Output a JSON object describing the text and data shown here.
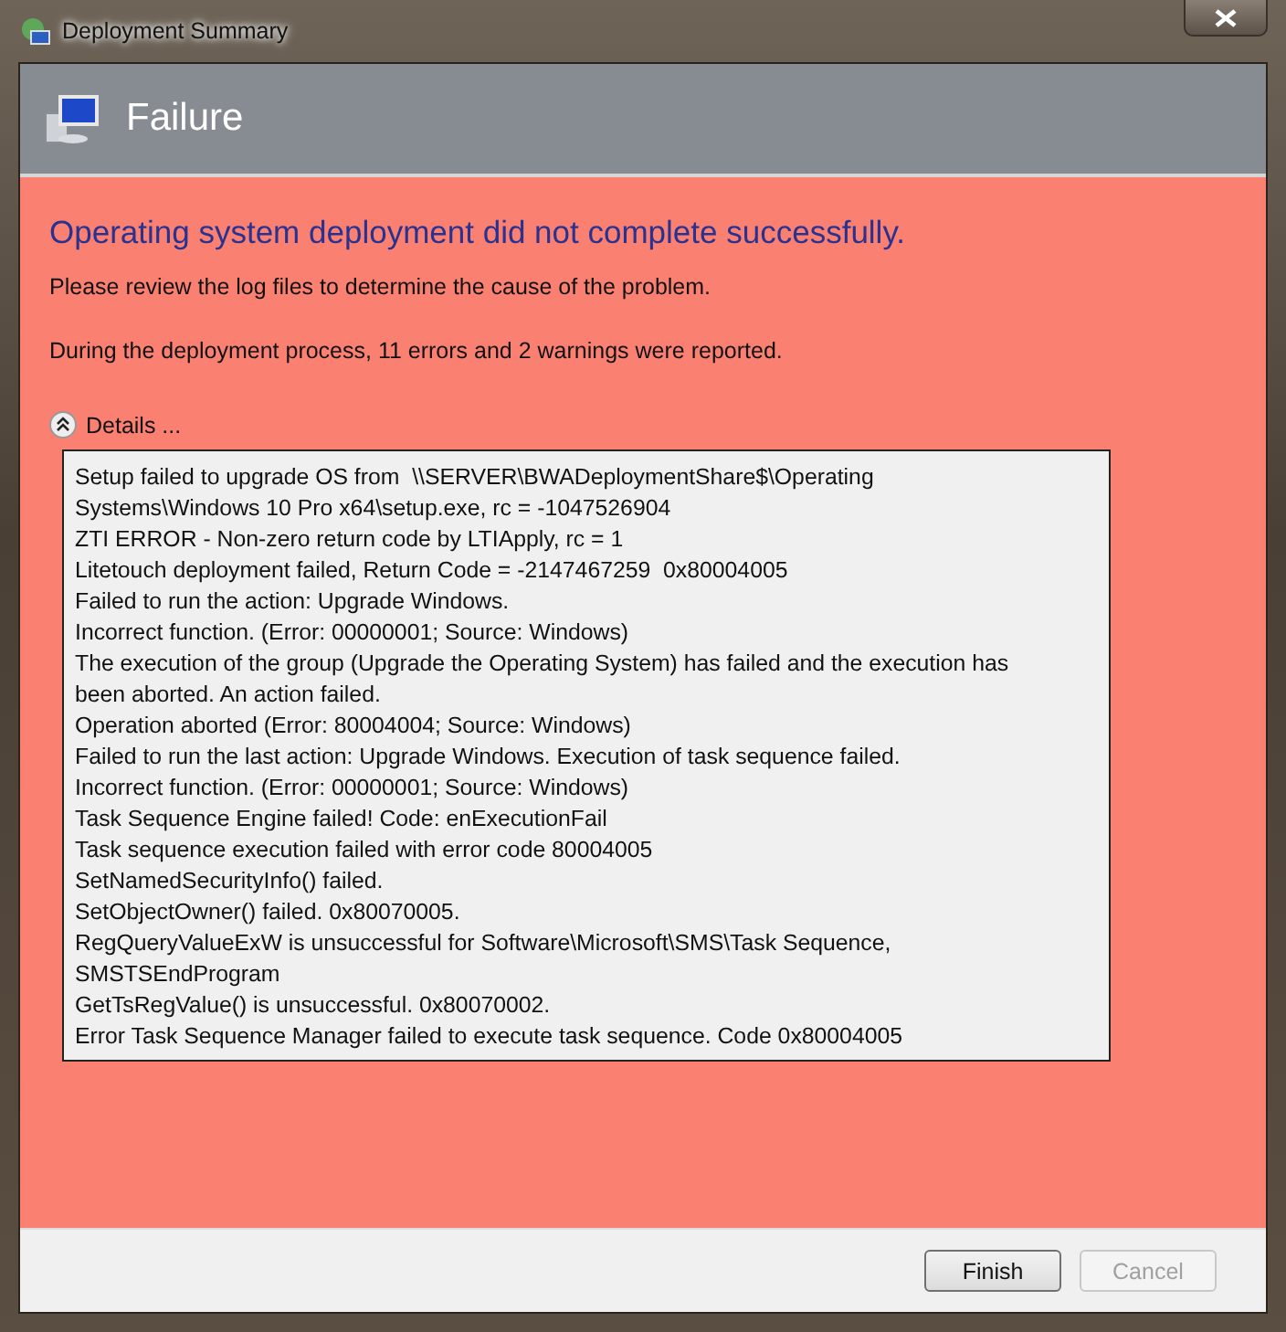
{
  "window": {
    "title": "Deployment Summary"
  },
  "header": {
    "title": "Failure"
  },
  "body": {
    "heading": "Operating system deployment did not complete successfully.",
    "messages": [
      "Please review the log files to determine the cause of the problem.",
      "During the deployment process, 11 errors and 2 warnings were reported."
    ],
    "details": {
      "label": "Details ...",
      "expanded": true,
      "lines": [
        "Setup failed to upgrade OS from  \\\\SERVER\\BWADeploymentShare$\\Operating",
        "Systems\\Windows 10 Pro x64\\setup.exe, rc = -1047526904",
        "ZTI ERROR - Non-zero return code by LTIApply, rc = 1",
        "Litetouch deployment failed, Return Code = -2147467259  0x80004005",
        "Failed to run the action: Upgrade Windows.",
        "Incorrect function. (Error: 00000001; Source: Windows)",
        "The execution of the group (Upgrade the Operating System) has failed and the execution has",
        "been aborted. An action failed.",
        "Operation aborted (Error: 80004004; Source: Windows)",
        "Failed to run the last action: Upgrade Windows. Execution of task sequence failed.",
        "Incorrect function. (Error: 00000001; Source: Windows)",
        "Task Sequence Engine failed! Code: enExecutionFail",
        "Task sequence execution failed with error code 80004005",
        "SetNamedSecurityInfo() failed.",
        "SetObjectOwner() failed. 0x80070005.",
        "RegQueryValueExW is unsuccessful for Software\\Microsoft\\SMS\\Task Sequence,",
        "SMSTSEndProgram",
        "GetTsRegValue() is unsuccessful. 0x80070002.",
        "Error Task Sequence Manager failed to execute task sequence. Code 0x80004005"
      ]
    }
  },
  "buttons": [
    {
      "label": "Finish",
      "disabled": false
    },
    {
      "label": "Cancel",
      "disabled": true
    }
  ]
}
